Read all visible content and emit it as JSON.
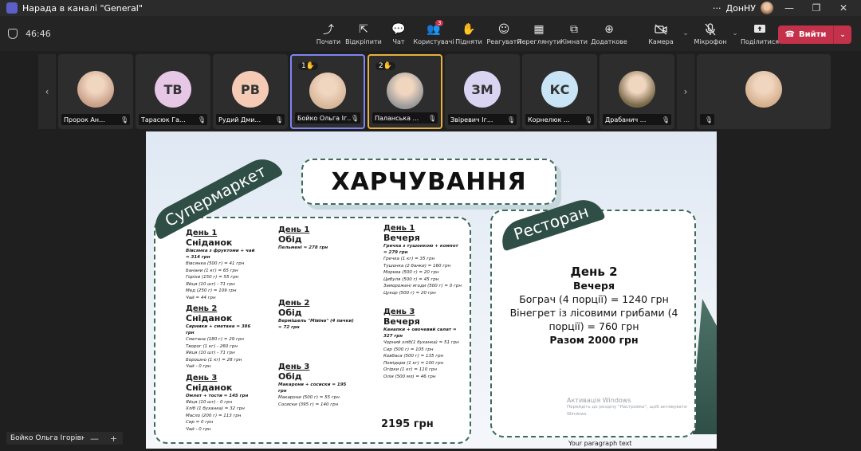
{
  "window": {
    "title": "Нарада в каналі \"General\"",
    "user": "ДонНУ",
    "more": "···",
    "min": "—",
    "restore": "❐",
    "close": "✕"
  },
  "toolbar": {
    "timer": "46:46",
    "tools": [
      {
        "icon": "⤴",
        "label": "Почати",
        "name": "start-button"
      },
      {
        "icon": "⇱",
        "label": "Відкріпити",
        "name": "unpin-button"
      },
      {
        "icon": "💬",
        "label": "Чат",
        "name": "chat-button"
      },
      {
        "icon": "👥",
        "label": "Користувачі",
        "name": "people-button",
        "badge": "3"
      },
      {
        "icon": "✋",
        "label": "Підняти",
        "name": "raise-hand-button"
      },
      {
        "icon": "☺",
        "label": "Реагувати",
        "name": "react-button"
      },
      {
        "icon": "▦",
        "label": "Переглянути",
        "name": "view-button"
      },
      {
        "icon": "⧉",
        "label": "Кімнати",
        "name": "rooms-button"
      },
      {
        "icon": "⊕",
        "label": "Додаткове",
        "name": "more-button"
      }
    ],
    "camera_label": "Камера",
    "mic_label": "Мікрофон",
    "share_label": "Поділитися",
    "leave_label": "Вийти"
  },
  "participants": [
    {
      "name": "Пророк Ан...",
      "initials": "",
      "color": "#c9a08a"
    },
    {
      "name": "Тарасюк Га...",
      "initials": "ТВ",
      "color": "#e7c7e6"
    },
    {
      "name": "Рудий Дми...",
      "initials": "РВ",
      "color": "#f5cbb5"
    },
    {
      "name": "Бойко Ольга Іг...",
      "initials": "",
      "color": "#d8b79a",
      "hand": "1✋",
      "hl": "hl1"
    },
    {
      "name": "Паланська ...",
      "initials": "",
      "color": "#9a9a9a",
      "hand": "2✋",
      "hl": "hl2"
    },
    {
      "name": "Звіревич Іг...",
      "initials": "ЗМ",
      "color": "#d8d4f2"
    },
    {
      "name": "Корнелюк ...",
      "initials": "КС",
      "color": "#c8e4f5"
    },
    {
      "name": "Драбанич ...",
      "initials": "",
      "color": "#7a6a4a"
    },
    {
      "name": "",
      "initials": "",
      "color": "#d6b08e",
      "self": true
    }
  ],
  "slide": {
    "title": "ХАРЧУВАННЯ",
    "ribbon_left": "Супермаркет",
    "ribbon_right": "Ресторан",
    "col1": [
      {
        "day": "День 1",
        "meal": "Сніданок",
        "head": "Вівсянка з фруктоми + чай = 314 грн",
        "items": [
          "Вівсянка (500 г) = 41 грн",
          "Банани (1 кг) = 65 грн",
          "Горіхи (150 г) = 55 грн",
          "Яйця (10 шт) - 71 грн",
          "Мед (250 г) = 109 грн",
          "Чай = 44 грн"
        ]
      },
      {
        "day": "День 2",
        "meal": "Сніданок",
        "head": "Сирники + сметана = 386 грн",
        "items": [
          "Сметана (180 г) = 29 грн",
          "Творог (1 кг) - 260 грн",
          "Яйця (10 шт) - 71 грн",
          "Борошно (1 кг) = 28 грн",
          "Чай - 0 грн"
        ]
      },
      {
        "day": "День 3",
        "meal": "Сніданок",
        "head": "Омлет + тости = 145 грн",
        "items": [
          "Яйця (10 шт) - 0 грн",
          "Хліб (1 буханка) = 32 грн",
          "Масло (200 г) = 113 грн",
          "Сир = 0 грн",
          "Чай - 0 грн"
        ]
      }
    ],
    "col2": [
      {
        "day": "День 1",
        "meal": "Обід",
        "head": "Пельмені = 278 грн"
      },
      {
        "day": "День 2",
        "meal": "Обід",
        "head": "Вермішель \"Мівіна\" (4 пачки) = 72 грн"
      },
      {
        "day": "День 3",
        "meal": "Обід",
        "head": "Макарони + сосиски = 195 грн",
        "items": [
          "Макарони (500 г) = 55 грн",
          "Сосиски (395 г) = 140 грн"
        ]
      }
    ],
    "col3": [
      {
        "day": "День 1",
        "meal": "Вечеря",
        "head": "Гречка з тушонкою + компот = 279 грн",
        "items": [
          "Гречка (1 кг) = 35 грн",
          "Тушонка (2 банки) = 160 грн",
          "Морква (500 г) = 20 грн",
          "Цибуля (500 г) = 45 грн",
          "Заморожені ягоди (500 г) = 0 грн",
          "Цукор (500 г) = 20 грн"
        ]
      },
      {
        "day": "День 3",
        "meal": "Вечеря",
        "head": "Канапки + овочевий салат = 327 грн",
        "items": [
          "Чорний хліб(1 буханка) = 51 грн",
          "Сир (500 г) = 105 грн",
          "Ковбаса (500 г) = 135 грн",
          "Помідори (1 кг) = 100 грн",
          "Огірки (1 кг) = 110 грн",
          "Олія (500 мл) = 46 грн"
        ]
      }
    ],
    "total_left": "2195 грн",
    "restaurant": {
      "day": "День 2",
      "meal": "Вечеря",
      "line1": "Бограч (4 порції) = 1240 грн",
      "line2": "Вінегрет із лісовими грибами (4 порції) = 760 грн",
      "total": "Разом 2000 грн"
    },
    "watermark": "Активація Windows",
    "watermark_sub": "Перейдіть до розділу \"Настройки\", щоб активувати Windows.",
    "caption": "Your paragraph text"
  },
  "presenter": {
    "name": "Бойко Ольга Ігорівна",
    "zoom_out": "—",
    "zoom_in": "+"
  }
}
